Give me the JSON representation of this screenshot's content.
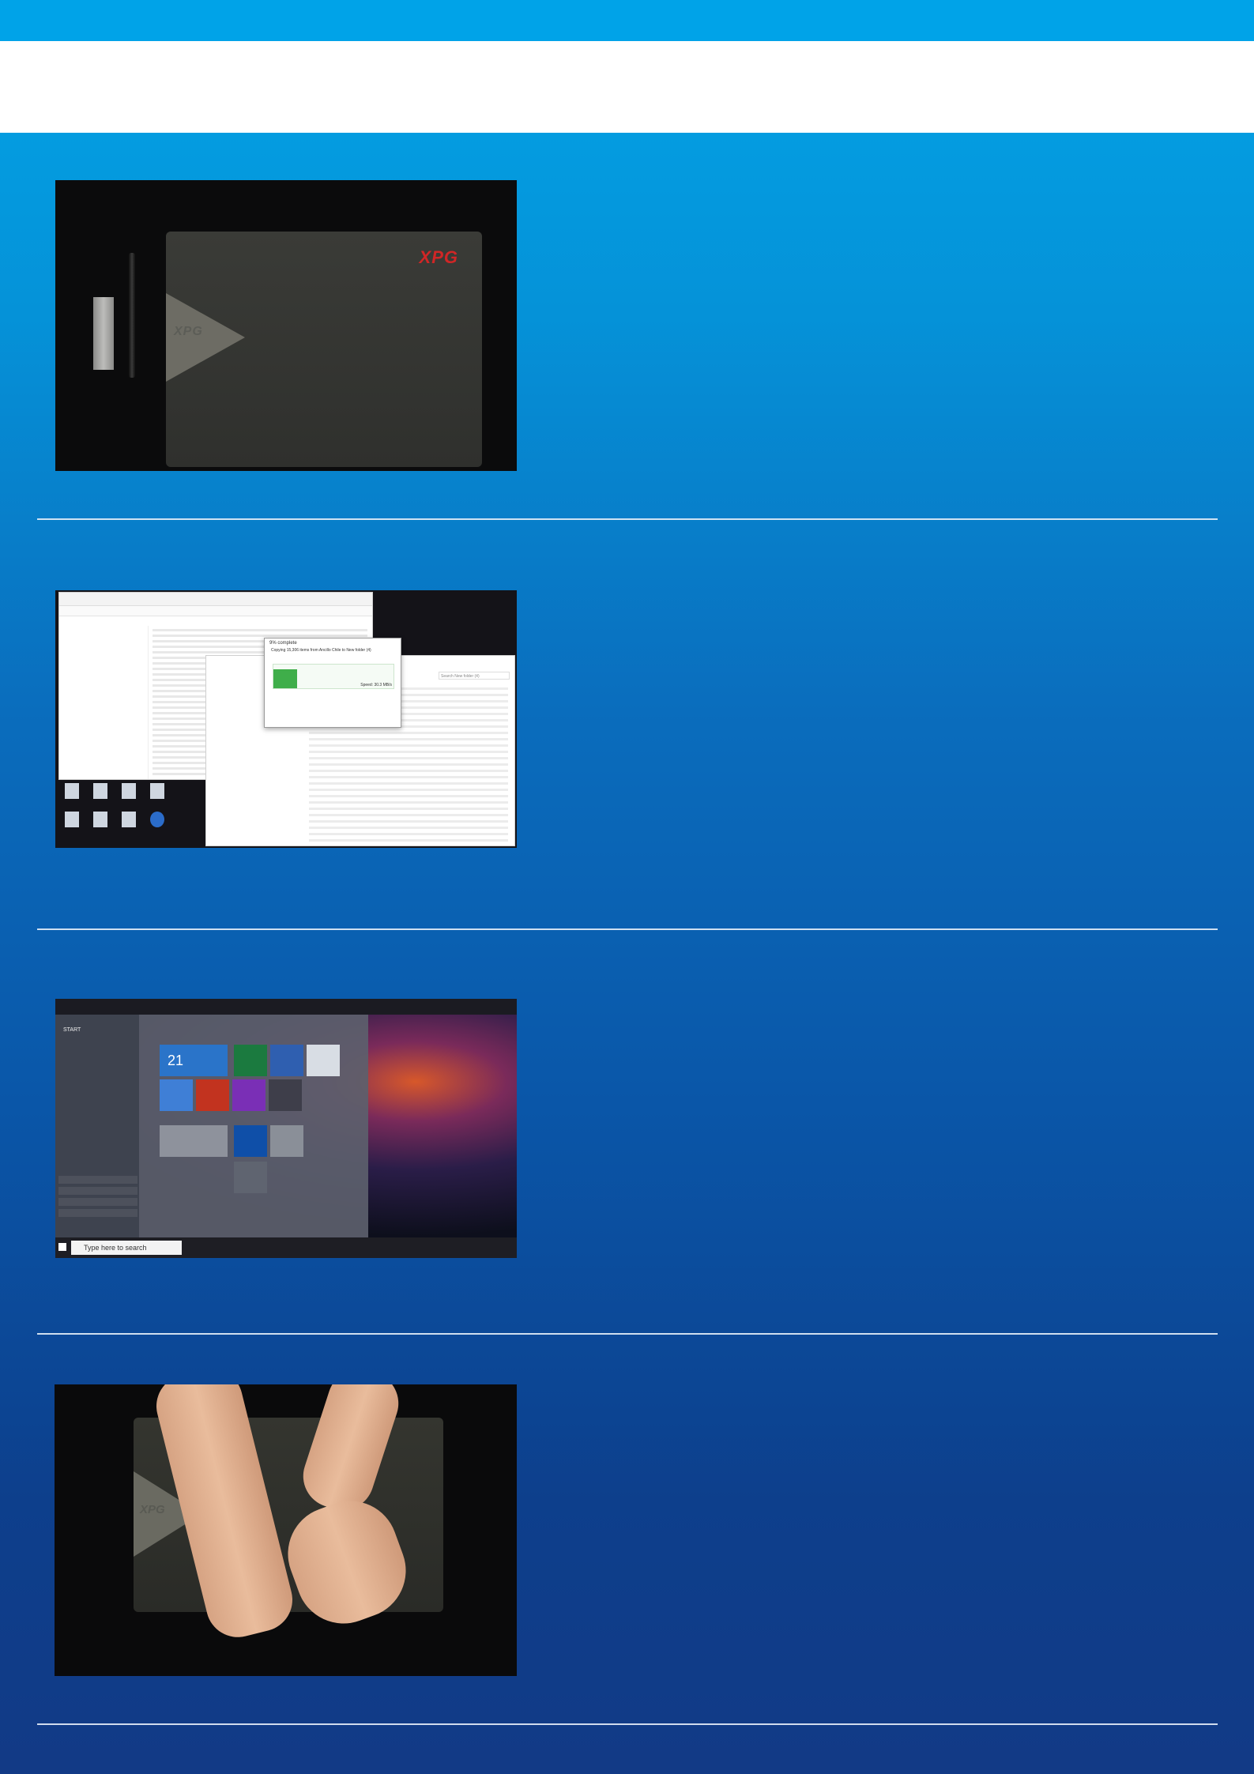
{
  "panels": {
    "unboxing": {
      "lid_logo": "XPG",
      "corner_logo": "XPG"
    },
    "file_copy": {
      "dialog_title": "9% complete",
      "copying_line": "Copying 15,306 items from Ancillo Chile to New folder (4)",
      "speed": "Speed: 30.3 MB/s",
      "search_placeholder": "Search New folder (4)"
    },
    "start_menu": {
      "start_label": "START",
      "date_tile": "21",
      "search_placeholder": "Type here to search"
    },
    "hands": {
      "lid_logo": "XPG"
    }
  }
}
